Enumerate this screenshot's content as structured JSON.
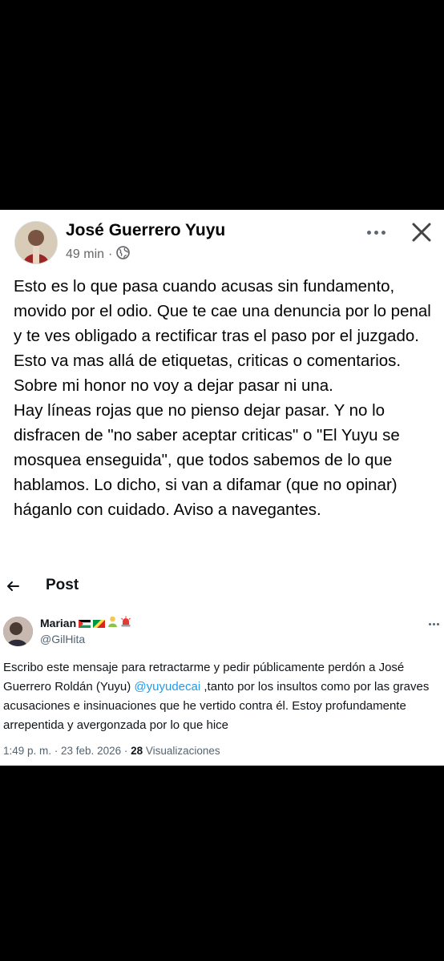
{
  "facebook_post": {
    "author_name": "José Guerrero Yuyu",
    "time_ago": "49 min",
    "separator": "·",
    "audience_icon": "globe-icon",
    "more_icon": "more-horizontal-icon",
    "close_icon": "close-icon",
    "paragraph_1": "Esto es lo que pasa cuando acusas sin fundamento, movido por el odio. Que te cae una denuncia por lo penal y te ves obligado a rectificar tras el paso por el juzgado. Esto va mas allá de etiquetas, criticas o comentarios. Sobre mi honor no voy a dejar pasar ni una.",
    "paragraph_2": "Hay líneas rojas que no pienso dejar pasar. Y no lo disfracen de \"no saber aceptar criticas\" o \"El Yuyu se mosquea enseguida\", que todos sabemos de lo que hablamos. Lo dicho, si van a difamar (que no opinar) háganlo con cuidado. Aviso a navegantes."
  },
  "tweet": {
    "header_title": "Post",
    "back_icon": "arrow-left-icon",
    "display_name": "Marian",
    "handle": "@GilHita",
    "text_before_mention": "Escribo este mensaje para retractarme y pedir públicamente perdón a José Guerrero Roldán (Yuyu) ",
    "mention": "@yuyudecai",
    "text_after_mention": " ,tanto por los insultos como por las graves acusaciones e insinuaciones que he vertido contra él. Estoy profundamente arrepentida y avergonzada por lo que hice",
    "timestamp": "1:49 p. m. · 23 feb. 2026 · ",
    "views_count": "28",
    "views_label": " Visualizaciones"
  },
  "colors": {
    "background": "#000000",
    "card": "#ffffff",
    "link": "#1d9bf0",
    "secondary_text": "#65676b"
  }
}
